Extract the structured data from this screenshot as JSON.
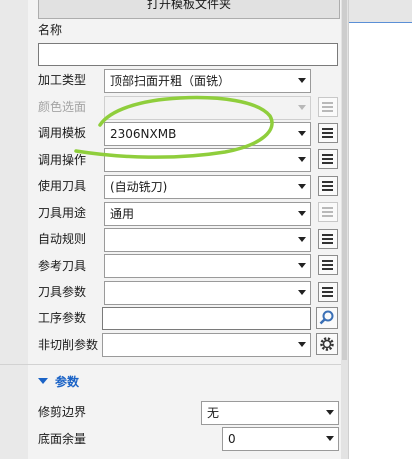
{
  "toolbar": {
    "open_template_file": "打开模板文件夹"
  },
  "form": {
    "name_label": "名称",
    "name_value": "",
    "fields": [
      {
        "label": "加工类型",
        "value": "顶部扫面开粗（面铣）"
      },
      {
        "label": "颜色选面",
        "value": ""
      },
      {
        "label": "调用模板",
        "value": "2306NXMB"
      },
      {
        "label": "调用操作",
        "value": ""
      },
      {
        "label": "使用刀具",
        "value": "(自动铣刀)"
      },
      {
        "label": "刀具用途",
        "value": "通用"
      },
      {
        "label": "自动规则",
        "value": ""
      },
      {
        "label": "参考刀具",
        "value": ""
      },
      {
        "label": "刀具参数",
        "value": ""
      },
      {
        "label": "工序参数",
        "value": ""
      },
      {
        "label": "非切削参数",
        "value": ""
      }
    ]
  },
  "params_section": {
    "title": "参数",
    "rows": [
      {
        "label": "修剪边界",
        "value": "无"
      },
      {
        "label": "底面余量",
        "value": "0"
      }
    ]
  },
  "colors": {
    "accent": "#1b63c6",
    "annotation": "#8fce3c"
  },
  "icons": [
    "list-icon",
    "search-icon",
    "gear-icon",
    "dropdown-arrow-icon",
    "collapse-arrow-icon"
  ]
}
